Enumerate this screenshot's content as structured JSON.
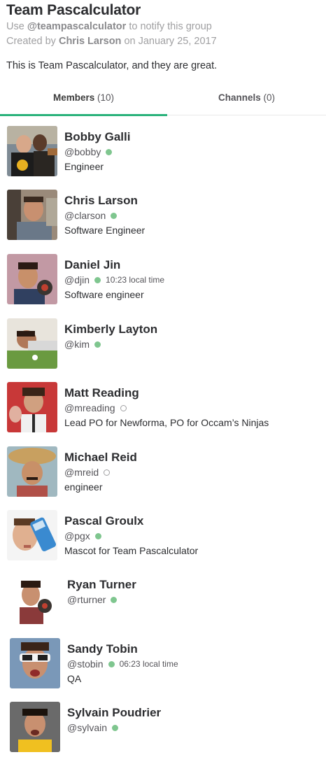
{
  "group": {
    "title": "Team Pascalculator",
    "notify_prefix": "Use",
    "handle": "@teampascalculator",
    "notify_suffix": "to notify this group",
    "created_prefix": "Created by",
    "creator": "Chris Larson",
    "created_suffix": "on January 25, 2017",
    "description": "This is Team Pascalculator, and they are great."
  },
  "tabs": [
    {
      "label": "Members",
      "count": "(10)"
    },
    {
      "label": "Channels",
      "count": "(0)"
    }
  ],
  "colors": {
    "accent": "#2ab27b",
    "active_dot": "#7fc68f",
    "away_dot": "#a0a0a2"
  },
  "members": [
    {
      "name": "Bobby Galli",
      "handle": "@bobby",
      "presence": "active",
      "local_time": "",
      "role": "Engineer"
    },
    {
      "name": "Chris Larson",
      "handle": "@clarson",
      "presence": "active",
      "local_time": "",
      "role": "Software Engineer"
    },
    {
      "name": "Daniel Jin",
      "handle": "@djin",
      "presence": "active",
      "local_time": "10:23 local time",
      "role": "Software engineer"
    },
    {
      "name": "Kimberly Layton",
      "handle": "@kim",
      "presence": "active",
      "local_time": "",
      "role": ""
    },
    {
      "name": "Matt Reading",
      "handle": "@mreading",
      "presence": "away",
      "local_time": "",
      "role": "Lead PO for Newforma, PO for Occam’s Ninjas"
    },
    {
      "name": "Michael Reid",
      "handle": "@mreid",
      "presence": "away",
      "local_time": "",
      "role": "engineer"
    },
    {
      "name": "Pascal Groulx",
      "handle": "@pgx",
      "presence": "active",
      "local_time": "",
      "role": "Mascot for Team Pascalculator"
    },
    {
      "name": "Ryan Turner",
      "handle": "@rturner",
      "presence": "active",
      "local_time": "",
      "role": ""
    },
    {
      "name": "Sandy Tobin",
      "handle": "@stobin",
      "presence": "active",
      "local_time": "06:23 local time",
      "role": "QA"
    },
    {
      "name": "Sylvain Poudrier",
      "handle": "@sylvain",
      "presence": "active",
      "local_time": "",
      "role": ""
    }
  ]
}
